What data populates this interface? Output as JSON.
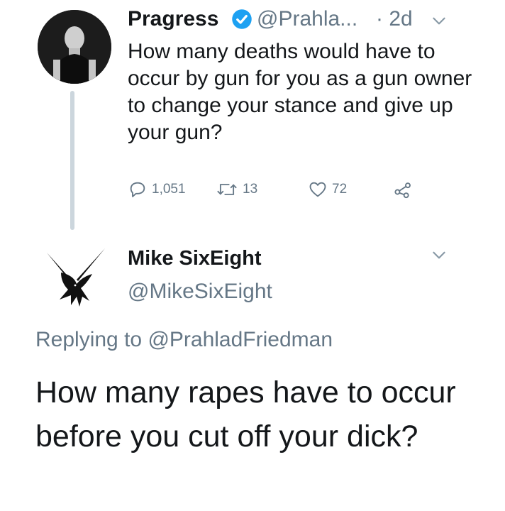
{
  "parent_tweet": {
    "display_name": "Pragress",
    "handle": "@Prahla...",
    "time": "· 2d",
    "text": "How many deaths would have to occur by gun for you as a gun owner to change your stance and give up your gun?",
    "replies": "1,051",
    "retweets": "13",
    "likes": "72",
    "icons": {
      "verified": "verified-badge-icon",
      "menu": "chevron-down-icon",
      "reply": "reply-icon",
      "retweet": "retweet-icon",
      "like": "heart-icon",
      "share": "share-icon"
    },
    "colors": {
      "verified": "#1da1f2",
      "muted": "#657786",
      "thread_line": "#ccd6dd"
    }
  },
  "reply_tweet": {
    "display_name": "Mike SixEight",
    "handle": "@MikeSixEight",
    "replying_prefix": "Replying to ",
    "replying_to": "@PrahladFriedman",
    "text": "How many rapes have to occur before you cut off your dick?",
    "icons": {
      "avatar": "crow-avatar-icon",
      "menu": "chevron-down-icon"
    }
  }
}
